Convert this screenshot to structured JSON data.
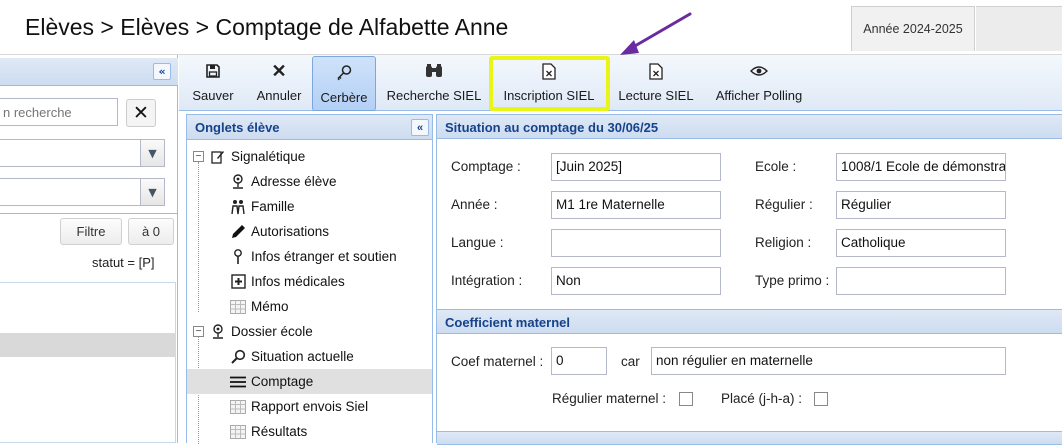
{
  "header": {
    "title": "Elèves > Elèves > Comptage de Alfabette Anne",
    "year_tab": "Année 2024-2025"
  },
  "left_panel": {
    "collapse_icon": "«",
    "search_placeholder": "n recherche",
    "clear_icon": "✕",
    "filter_button": "Filtre",
    "reset_button": "à 0",
    "status_text": "statut = [P]"
  },
  "toolbar": {
    "buttons": [
      {
        "label": "Sauver",
        "icon": "save-icon"
      },
      {
        "label": "Annuler",
        "icon": "close-icon"
      },
      {
        "label": "Cerbère",
        "icon": "key-icon"
      },
      {
        "label": "Recherche SIEL",
        "icon": "binoculars-icon"
      },
      {
        "label": "Inscription SIEL",
        "icon": "document-icon"
      },
      {
        "label": "Lecture SIEL",
        "icon": "document-icon"
      },
      {
        "label": "Afficher Polling",
        "icon": "eye-icon"
      }
    ],
    "highlight_color": "#e8f516",
    "arrow_color": "#6a2aa0"
  },
  "tree": {
    "header": "Onglets élève",
    "collapse_icon": "«",
    "items": [
      {
        "label": "Signalétique",
        "level": 0
      },
      {
        "label": "Adresse élève",
        "level": 1
      },
      {
        "label": "Famille",
        "level": 1
      },
      {
        "label": "Autorisations",
        "level": 1
      },
      {
        "label": "Infos étranger et soutien",
        "level": 1
      },
      {
        "label": "Infos médicales",
        "level": 1
      },
      {
        "label": "Mémo",
        "level": 1
      },
      {
        "label": "Dossier école",
        "level": 0
      },
      {
        "label": "Situation actuelle",
        "level": 1
      },
      {
        "label": "Comptage",
        "level": 1,
        "selected": true
      },
      {
        "label": "Rapport envois Siel",
        "level": 1
      },
      {
        "label": "Résultats",
        "level": 1
      }
    ]
  },
  "form": {
    "section1_title": "Situation au comptage du 30/06/25",
    "comptage_label": "Comptage :",
    "comptage_value": "[Juin 2025]",
    "ecole_label": "Ecole :",
    "ecole_value": "1008/1 Ecole de démonstra",
    "annee_label": "Année :",
    "annee_value": "M1 1re Maternelle",
    "regulier_label": "Régulier :",
    "regulier_value": "Régulier",
    "langue_label": "Langue :",
    "langue_value": "",
    "religion_label": "Religion :",
    "religion_value": "Catholique",
    "integration_label": "Intégration :",
    "integration_value": "Non",
    "type_primo_label": "Type primo :",
    "type_primo_value": "",
    "section2_title": "Coefficient maternel",
    "coef_label": "Coef maternel :",
    "coef_value": "0",
    "car_label": "car",
    "car_value": "non régulier en maternelle",
    "regulier_maternel_label": "Régulier maternel :",
    "place_label": "Placé (j-h-a) :"
  }
}
